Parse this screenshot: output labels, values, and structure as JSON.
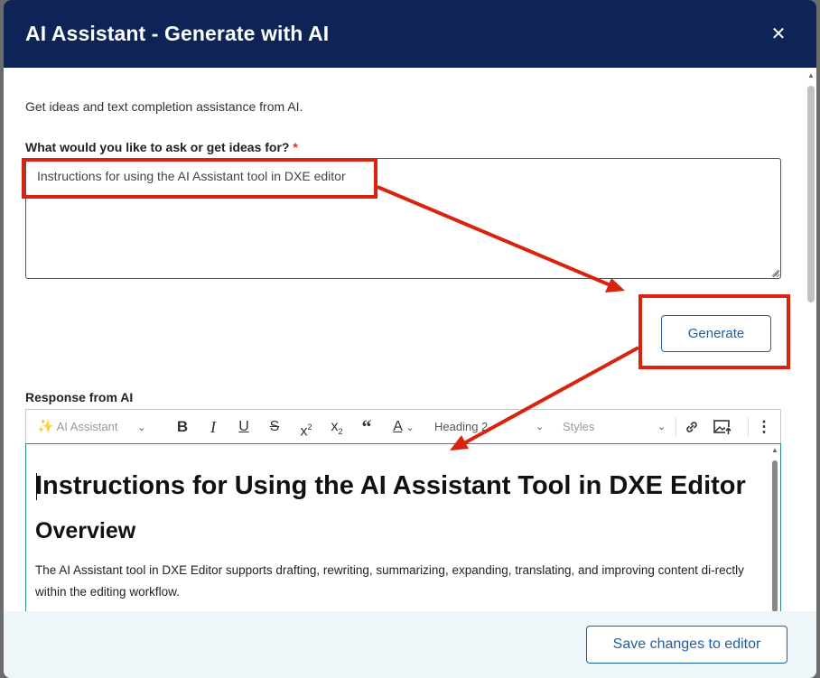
{
  "dialog": {
    "title": "AI Assistant - Generate with AI",
    "close_glyph": "✕"
  },
  "body": {
    "description": "Get ideas and text completion assistance from AI.",
    "prompt_label": "What would you like to ask or get ideas for?",
    "required_mark": "*",
    "prompt_value": "Instructions for using the AI Assistant tool in DXE editor",
    "generate_label": "Generate",
    "response_label": "Response from AI"
  },
  "toolbar": {
    "ai_assistant_label": "AI Assistant",
    "heading_select_value": "Heading 2",
    "styles_select_placeholder": "Styles",
    "buttons": [
      "bold",
      "italic",
      "underline",
      "strikethrough",
      "superscript",
      "subscript",
      "blockquote",
      "font-color",
      "link",
      "insert-image",
      "more"
    ]
  },
  "editor": {
    "h1": "Instructions for Using the AI Assistant Tool in DXE Editor",
    "h2": "Overview",
    "paragraph": "The AI Assistant tool in DXE Editor supports drafting, rewriting, summarizing, expanding, translating, and improving content di-rectly within the editing workflow."
  },
  "footer": {
    "save_label": "Save changes to editor"
  },
  "colors": {
    "header_bg": "#0f2456",
    "primary": "#1f5fa8",
    "annotation_red": "#d9230f",
    "footer_bg": "#eef6f9"
  }
}
